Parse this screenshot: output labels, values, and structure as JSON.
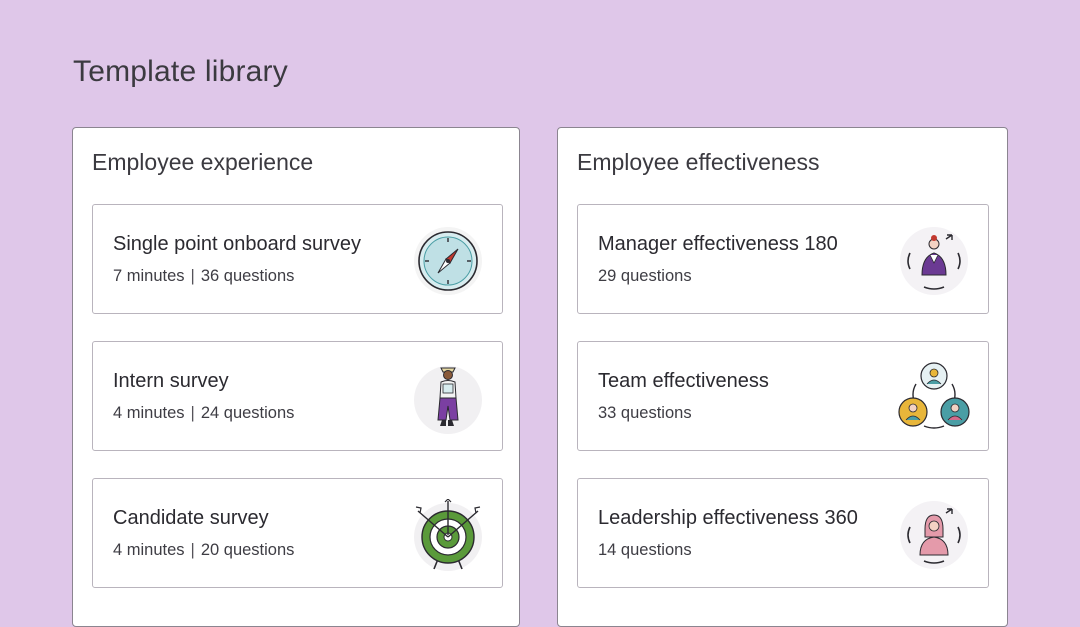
{
  "page": {
    "title": "Template library"
  },
  "panels": [
    {
      "title": "Employee experience",
      "cards": [
        {
          "title": "Single point onboard survey",
          "duration": "7 minutes",
          "questions": "36 questions",
          "icon": "compass-icon"
        },
        {
          "title": "Intern survey",
          "duration": "4 minutes",
          "questions": "24 questions",
          "icon": "intern-person-icon"
        },
        {
          "title": "Candidate survey",
          "duration": "4 minutes",
          "questions": "20 questions",
          "icon": "target-icon"
        }
      ]
    },
    {
      "title": "Employee effectiveness",
      "cards": [
        {
          "title": "Manager effectiveness 180",
          "questions": "29 questions",
          "icon": "manager-person-icon"
        },
        {
          "title": "Team effectiveness",
          "questions": "33 questions",
          "icon": "team-cycle-icon"
        },
        {
          "title": "Leadership effectiveness 360",
          "questions": "14 questions",
          "icon": "leader-person-icon"
        }
      ]
    }
  ],
  "meta_separator": "|",
  "colors": {
    "background": "#dfc7e9",
    "card_border": "#b9b4bd",
    "accent_green": "#5a9a3a",
    "accent_purple": "#6b3a93",
    "accent_teal": "#4a9ea5",
    "accent_yellow": "#e8b63a"
  }
}
